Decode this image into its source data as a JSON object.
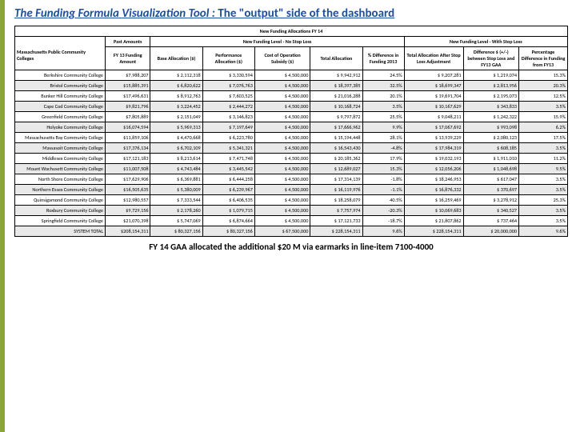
{
  "title_left": "The Funding Formula Visualization Tool :",
  "title_right": "The \"output\" side of the dashboard",
  "banner": "New Funding Allocations FY 14",
  "sections": {
    "past": "Past Amounts",
    "nostop": "New Funding Level - No Stop Loss",
    "withstop": "New Funding Level - With Stop Loss"
  },
  "cornerLabel": "Massachusetts Public Community Colleges",
  "headers": {
    "fy13": "FY 13 Funding Amount",
    "base": "Base Allocation ($)",
    "perf": "Performance Allocation ($)",
    "cost": "Cost of Operation Subsidy ($)",
    "total": "Total Allocation",
    "pctdiff": "% Difference in Funding 2013",
    "afterstop": "Total Allocation After Stop Loss Adjustment",
    "diffdollar": "Difference $ (+/-) between Stop Loss and FY13 GAA",
    "pctg": "Percentage Difference in Funding from FY13"
  },
  "rows": [
    {
      "name": "Berkshire Community College",
      "fy13": "$7,988,207",
      "base": "$  2,112,318",
      "perf": "$  3,330,594",
      "cost": "$  4,500,000",
      "total": "$      9,942,912",
      "pct": "24.5%",
      "after": "$    9,207,281",
      "diff": "$  1,219,074",
      "pctg": "15.3%"
    },
    {
      "name": "Bristol Community College",
      "fy13": "$15,885,391",
      "base": "$  6,820,622",
      "perf": "$  7,076,763",
      "cost": "$  4,500,000",
      "total": "$    18,397,385",
      "pct": "32.5%",
      "after": "$  18,699,347",
      "diff": "$  2,813,956",
      "pctg": "20.3%"
    },
    {
      "name": "Bunker Hill Community College",
      "fy13": "$17,496,631",
      "base": "$  8,912,763",
      "perf": "$  7,603,525",
      "cost": "$  4,500,000",
      "total": "$    21,016,288",
      "pct": "20.1%",
      "after": "$  19,691,704",
      "diff": "$  2,195,073",
      "pctg": "12.5%"
    },
    {
      "name": "Cape Cod Community College",
      "fy13": "$9,821,796",
      "base": "$  3,224,452",
      "perf": "$  2,444,272",
      "cost": "$  4,500,000",
      "total": "$    10,168,724",
      "pct": "3.5%",
      "after": "$  10,167,629",
      "diff": "$     343,833",
      "pctg": "3.5%"
    },
    {
      "name": "Greenfield Community College",
      "fy13": "$7,805,889",
      "base": "$  2,151,049",
      "perf": "$  3,146,823",
      "cost": "$  4,500,000",
      "total": "$      9,797,872",
      "pct": "25.5%",
      "after": "$    9,048,211",
      "diff": "$  1,242,322",
      "pctg": "15.9%"
    },
    {
      "name": "Holyoke Community College",
      "fy13": "$16,074,594",
      "base": "$  5,969,313",
      "perf": "$  7,197,649",
      "cost": "$  4,500,000",
      "total": "$    17,666,962",
      "pct": "9.9%",
      "after": "$  17,067,692",
      "diff": "$     993,098",
      "pctg": "6.2%"
    },
    {
      "name": "Massachusetts Bay Community College",
      "fy13": "$11,859,106",
      "base": "$  4,470,668",
      "perf": "$  6,223,780",
      "cost": "$  4,500,000",
      "total": "$    15,194,448",
      "pct": "28.1%",
      "after": "$  13,939,229",
      "diff": "$  2,080,123",
      "pctg": "17.5%"
    },
    {
      "name": "Massasoit Community College",
      "fy13": "$17,376,134",
      "base": "$  6,702,109",
      "perf": "$  5,341,321",
      "cost": "$  4,500,000",
      "total": "$    16,543,430",
      "pct": "-4.8%",
      "after": "$  17,984,319",
      "diff": "$     608,185",
      "pctg": "3.5%"
    },
    {
      "name": "Middlesex Community College",
      "fy13": "$17,121,183",
      "base": "$  8,213,614",
      "perf": "$  7,471,748",
      "cost": "$  4,500,000",
      "total": "$    20,185,362",
      "pct": "17.9%",
      "after": "$  19,032,193",
      "diff": "$  1,911,010",
      "pctg": "11.2%"
    },
    {
      "name": "Mount Wachusett Community College",
      "fy13": "$11,007,508",
      "base": "$  4,743,484",
      "perf": "$  3,445,542",
      "cost": "$  4,500,000",
      "total": "$    12,689,027",
      "pct": "15.3%",
      "after": "$  12,056,206",
      "diff": "$  1,048,698",
      "pctg": "9.5%"
    },
    {
      "name": "North Shore Community College",
      "fy13": "$17,629,906",
      "base": "$  6,369,881",
      "perf": "$  6,444,258",
      "cost": "$  4,500,000",
      "total": "$    17,314,139",
      "pct": "-1.8%",
      "after": "$  18,246,953",
      "diff": "$     617,047",
      "pctg": "3.5%"
    },
    {
      "name": "Northern Essex Community College",
      "fy13": "$16,505,635",
      "base": "$  5,380,009",
      "perf": "$  6,239,967",
      "cost": "$  4,500,000",
      "total": "$    16,119,976",
      "pct": "-1.1%",
      "after": "$  16,876,332",
      "diff": "$     370,697",
      "pctg": "3.5%"
    },
    {
      "name": "Quinsigamond Community College",
      "fy13": "$12,980,557",
      "base": "$  7,333,544",
      "perf": "$  6,406,535",
      "cost": "$  4,500,000",
      "total": "$    18,258,079",
      "pct": "40.5%",
      "after": "$  16,259,469",
      "diff": "$  3,278,912",
      "pctg": "25.3%"
    },
    {
      "name": "Roxbury Community College",
      "fy13": "$9,729,156",
      "base": "$  2,178,260",
      "perf": "$  1,079,715",
      "cost": "$  4,500,000",
      "total": "$      7,757,974",
      "pct": "-20.3%",
      "after": "$  10,069,683",
      "diff": "$     340,527",
      "pctg": "3.5%"
    },
    {
      "name": "Springfield Community College",
      "fy13": "$21,070,398",
      "base": "$  5,747,069",
      "perf": "$  6,874,664",
      "cost": "$  4,500,000",
      "total": "$    17,121,733",
      "pct": "-18.7%",
      "after": "$  21,807,862",
      "diff": "$     737,464",
      "pctg": "3.5%"
    },
    {
      "name": "SYSTEM TOTAL",
      "fy13": "$208,154,311",
      "base": "$  80,327,156",
      "perf": "$  80,327,156",
      "cost": "$  67,500,000",
      "total": "$  228,154,311",
      "pct": "9.6%",
      "after": "$  228,154,311",
      "diff": "$  20,000,000",
      "pctg": "9.6%"
    }
  ],
  "footer": "FY 14 GAA allocated the additional $20 M via earmarks in line-item 7100-4000"
}
